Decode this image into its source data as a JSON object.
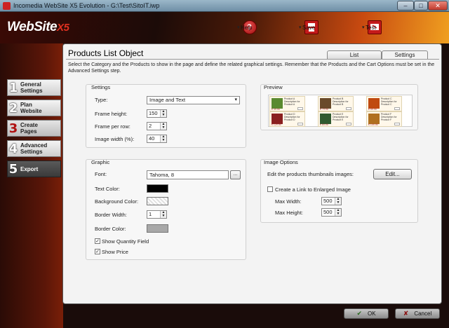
{
  "window": {
    "title": "Incomedia WebSite X5 Evolution - G:\\Test\\SitoIT.iwp",
    "minimize_glyph": "‒",
    "maximize_glyph": "□",
    "close_glyph": "✕"
  },
  "header": {
    "logo_text": "WebSite",
    "logo_suffix": "X5",
    "help_label": "Help",
    "save_label": "Save",
    "test_label": "Test",
    "help_glyph": "?",
    "caret_glyph": "▾"
  },
  "sidebar": {
    "steps": [
      {
        "num": "1",
        "label": "General Settings"
      },
      {
        "num": "2",
        "label": "Plan Website"
      },
      {
        "num": "3",
        "label": "Create Pages"
      },
      {
        "num": "4",
        "label": "Advanced Settings"
      },
      {
        "num": "5",
        "label": "Export"
      }
    ]
  },
  "page": {
    "title": "Products List Object",
    "tabs": [
      "List",
      "Settings"
    ],
    "active_tab": "Settings",
    "description": "Select the Category and the Products to show in the page and define the related graphical settings. Remember that the Products and the Cart Options must be set in the Advanced Settings step."
  },
  "settings": {
    "group_title": "Settings",
    "type_label": "Type:",
    "type_value": "Image and Text",
    "frame_height_label": "Frame height:",
    "frame_height_value": "150",
    "frame_per_row_label": "Frame per row:",
    "frame_per_row_value": "2",
    "image_width_label": "Image width (%):",
    "image_width_value": "40"
  },
  "graphic": {
    "group_title": "Graphic",
    "font_label": "Font:",
    "font_value": "Tahoma, 8",
    "font_button": "...",
    "text_color_label": "Text Color:",
    "text_color": "#000000",
    "background_color_label": "Background Color:",
    "border_width_label": "Border Width:",
    "border_width_value": "1",
    "border_color_label": "Border Color:",
    "border_color": "#a8a8a8",
    "show_quantity_label": "Show Quantity Field",
    "show_quantity_checked": true,
    "show_price_label": "Show Price",
    "show_price_checked": true,
    "check_glyph": "✓"
  },
  "preview": {
    "group_title": "Preview",
    "products": [
      {
        "name": "Product A",
        "desc": "Description for Product A",
        "price": "€ 39.95",
        "color": "#5a8a30"
      },
      {
        "name": "Product B",
        "desc": "Description for Product B",
        "price": "€ 79.95",
        "color": "#6a4a2a"
      },
      {
        "name": "Product C",
        "desc": "Description for Product C",
        "price": "€ 59.95",
        "color": "#c04a10"
      },
      {
        "name": "Product D",
        "desc": "Description for Product D",
        "price": "€ 129.95",
        "color": "#8a2020"
      },
      {
        "name": "Product E",
        "desc": "Description for Product E",
        "price": "€ 69.95",
        "color": "#305a30"
      },
      {
        "name": "Product F",
        "desc": "Description for Product F",
        "price": "€ 109.95",
        "color": "#b07020"
      }
    ]
  },
  "image_options": {
    "group_title": "Image Options",
    "edit_thumbs_label": "Edit the products thumbnails images:",
    "edit_button": "Edit...",
    "create_link_label": "Create a Link to Enlarged Image",
    "create_link_checked": false,
    "max_width_label": "Max Width:",
    "max_width_value": "500",
    "max_height_label": "Max Height:",
    "max_height_value": "500"
  },
  "footer": {
    "ok_label": "OK",
    "cancel_label": "Cancel",
    "ok_glyph": "✔",
    "cancel_glyph": "✘"
  },
  "spin_glyphs": {
    "up": "▲",
    "down": "▼"
  }
}
